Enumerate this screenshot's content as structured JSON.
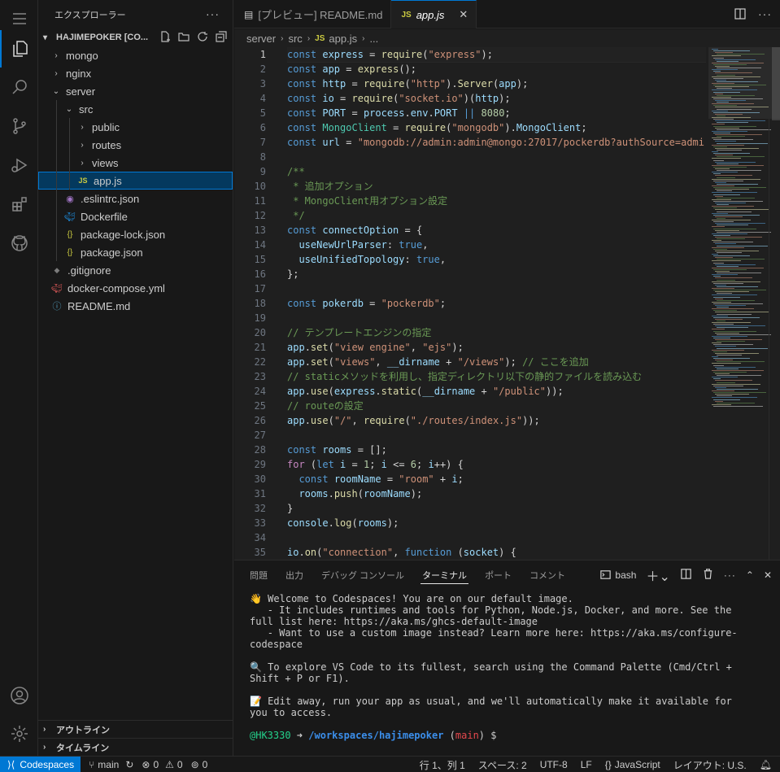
{
  "explorer": {
    "title": "エクスプローラー",
    "project": "HAJIMEPOKER [CO...",
    "tree": [
      {
        "label": "mongo",
        "depth": 0,
        "type": "folder",
        "open": false
      },
      {
        "label": "nginx",
        "depth": 0,
        "type": "folder",
        "open": false
      },
      {
        "label": "server",
        "depth": 0,
        "type": "folder",
        "open": true
      },
      {
        "label": "src",
        "depth": 1,
        "type": "folder",
        "open": true
      },
      {
        "label": "public",
        "depth": 2,
        "type": "folder",
        "open": false
      },
      {
        "label": "routes",
        "depth": 2,
        "type": "folder",
        "open": false
      },
      {
        "label": "views",
        "depth": 2,
        "type": "folder",
        "open": false
      },
      {
        "label": "app.js",
        "depth": 2,
        "type": "js",
        "selected": true
      },
      {
        "label": ".eslintrc.json",
        "depth": 1,
        "type": "eslint"
      },
      {
        "label": "Dockerfile",
        "depth": 1,
        "type": "docker"
      },
      {
        "label": "package-lock.json",
        "depth": 1,
        "type": "json"
      },
      {
        "label": "package.json",
        "depth": 1,
        "type": "json"
      },
      {
        "label": ".gitignore",
        "depth": 0,
        "type": "git"
      },
      {
        "label": "docker-compose.yml",
        "depth": 0,
        "type": "compose"
      },
      {
        "label": "README.md",
        "depth": 0,
        "type": "info"
      }
    ],
    "outline": "アウトライン",
    "timeline": "タイムライン"
  },
  "tabs": [
    {
      "label": "[プレビュー] README.md",
      "active": false,
      "icon": "preview-icon"
    },
    {
      "label": "app.js",
      "active": true,
      "icon": "js-icon"
    }
  ],
  "breadcrumb": {
    "items": [
      "server",
      "src",
      "app.js",
      "..."
    ]
  },
  "editor": {
    "current_line": 1,
    "lines": [
      [
        [
          "k",
          "const "
        ],
        [
          "v",
          "express"
        ],
        [
          "p",
          " = "
        ],
        [
          "f",
          "require"
        ],
        [
          "p",
          "("
        ],
        [
          "s",
          "\"express\""
        ],
        [
          "p",
          ");"
        ]
      ],
      [
        [
          "k",
          "const "
        ],
        [
          "v",
          "app"
        ],
        [
          "p",
          " = "
        ],
        [
          "f",
          "express"
        ],
        [
          "p",
          "();"
        ]
      ],
      [
        [
          "k",
          "const "
        ],
        [
          "v",
          "http"
        ],
        [
          "p",
          " = "
        ],
        [
          "f",
          "require"
        ],
        [
          "p",
          "("
        ],
        [
          "s",
          "\"http\""
        ],
        [
          "p",
          ")."
        ],
        [
          "f",
          "Server"
        ],
        [
          "p",
          "("
        ],
        [
          "v",
          "app"
        ],
        [
          "p",
          ");"
        ]
      ],
      [
        [
          "k",
          "const "
        ],
        [
          "v",
          "io"
        ],
        [
          "p",
          " = "
        ],
        [
          "f",
          "require"
        ],
        [
          "p",
          "("
        ],
        [
          "s",
          "\"socket.io\""
        ],
        [
          "p",
          ")("
        ],
        [
          "v",
          "http"
        ],
        [
          "p",
          ");"
        ]
      ],
      [
        [
          "k",
          "const "
        ],
        [
          "v",
          "PORT"
        ],
        [
          "p",
          " = "
        ],
        [
          "v",
          "process"
        ],
        [
          "p",
          "."
        ],
        [
          "v",
          "env"
        ],
        [
          "p",
          "."
        ],
        [
          "v",
          "PORT"
        ],
        [
          "p",
          " "
        ],
        [
          "k",
          "||"
        ],
        [
          "p",
          " "
        ],
        [
          "n",
          "8080"
        ],
        [
          "p",
          ";"
        ]
      ],
      [
        [
          "k",
          "const "
        ],
        [
          "cl",
          "MongoClient"
        ],
        [
          "p",
          " = "
        ],
        [
          "f",
          "require"
        ],
        [
          "p",
          "("
        ],
        [
          "s",
          "\"mongodb\""
        ],
        [
          "p",
          ")."
        ],
        [
          "v",
          "MongoClient"
        ],
        [
          "p",
          ";"
        ]
      ],
      [
        [
          "k",
          "const "
        ],
        [
          "v",
          "url"
        ],
        [
          "p",
          " = "
        ],
        [
          "s",
          "\"mongodb://admin:admin@mongo:27017/pockerdb?authSource=admi"
        ]
      ],
      [],
      [
        [
          "c",
          "/**"
        ]
      ],
      [
        [
          "c",
          " * 追加オプション"
        ]
      ],
      [
        [
          "c",
          " * MongoClient用オプション設定"
        ]
      ],
      [
        [
          "c",
          " */"
        ]
      ],
      [
        [
          "k",
          "const "
        ],
        [
          "v",
          "connectOption"
        ],
        [
          "p",
          " = {"
        ]
      ],
      [
        [
          "p",
          "  "
        ],
        [
          "v",
          "useNewUrlParser"
        ],
        [
          "p",
          ": "
        ],
        [
          "k",
          "true"
        ],
        [
          "p",
          ","
        ]
      ],
      [
        [
          "p",
          "  "
        ],
        [
          "v",
          "useUnifiedTopology"
        ],
        [
          "p",
          ": "
        ],
        [
          "k",
          "true"
        ],
        [
          "p",
          ","
        ]
      ],
      [
        [
          "p",
          "};"
        ]
      ],
      [],
      [
        [
          "k",
          "const "
        ],
        [
          "v",
          "pokerdb"
        ],
        [
          "p",
          " = "
        ],
        [
          "s",
          "\"pockerdb\""
        ],
        [
          "p",
          ";"
        ]
      ],
      [],
      [
        [
          "c",
          "// テンプレートエンジンの指定"
        ]
      ],
      [
        [
          "v",
          "app"
        ],
        [
          "p",
          "."
        ],
        [
          "f",
          "set"
        ],
        [
          "p",
          "("
        ],
        [
          "s",
          "\"view engine\""
        ],
        [
          "p",
          ", "
        ],
        [
          "s",
          "\"ejs\""
        ],
        [
          "p",
          ");"
        ]
      ],
      [
        [
          "v",
          "app"
        ],
        [
          "p",
          "."
        ],
        [
          "f",
          "set"
        ],
        [
          "p",
          "("
        ],
        [
          "s",
          "\"views\""
        ],
        [
          "p",
          ", "
        ],
        [
          "v",
          "__dirname"
        ],
        [
          "p",
          " + "
        ],
        [
          "s",
          "\"/views\""
        ],
        [
          "p",
          "); "
        ],
        [
          "c",
          "// ここを追加"
        ]
      ],
      [
        [
          "c",
          "// staticメソッドを利用し、指定ディレクトリ以下の静的ファイルを読み込む"
        ]
      ],
      [
        [
          "v",
          "app"
        ],
        [
          "p",
          "."
        ],
        [
          "f",
          "use"
        ],
        [
          "p",
          "("
        ],
        [
          "v",
          "express"
        ],
        [
          "p",
          "."
        ],
        [
          "f",
          "static"
        ],
        [
          "p",
          "("
        ],
        [
          "v",
          "__dirname"
        ],
        [
          "p",
          " + "
        ],
        [
          "s",
          "\"/public\""
        ],
        [
          "p",
          "));"
        ]
      ],
      [
        [
          "c",
          "// routeの設定"
        ]
      ],
      [
        [
          "v",
          "app"
        ],
        [
          "p",
          "."
        ],
        [
          "f",
          "use"
        ],
        [
          "p",
          "("
        ],
        [
          "s",
          "\"/\""
        ],
        [
          "p",
          ", "
        ],
        [
          "f",
          "require"
        ],
        [
          "p",
          "("
        ],
        [
          "s",
          "\"./routes/index.js\""
        ],
        [
          "p",
          "));"
        ]
      ],
      [],
      [
        [
          "k",
          "const "
        ],
        [
          "v",
          "rooms"
        ],
        [
          "p",
          " = [];"
        ]
      ],
      [
        [
          "kc",
          "for"
        ],
        [
          "p",
          " ("
        ],
        [
          "k",
          "let "
        ],
        [
          "v",
          "i"
        ],
        [
          "p",
          " = "
        ],
        [
          "n",
          "1"
        ],
        [
          "p",
          "; "
        ],
        [
          "v",
          "i"
        ],
        [
          "p",
          " <= "
        ],
        [
          "n",
          "6"
        ],
        [
          "p",
          "; "
        ],
        [
          "v",
          "i"
        ],
        [
          "p",
          "++) {"
        ]
      ],
      [
        [
          "p",
          "  "
        ],
        [
          "k",
          "const "
        ],
        [
          "v",
          "roomName"
        ],
        [
          "p",
          " = "
        ],
        [
          "s",
          "\"room\""
        ],
        [
          "p",
          " + "
        ],
        [
          "v",
          "i"
        ],
        [
          "p",
          ";"
        ]
      ],
      [
        [
          "p",
          "  "
        ],
        [
          "v",
          "rooms"
        ],
        [
          "p",
          "."
        ],
        [
          "f",
          "push"
        ],
        [
          "p",
          "("
        ],
        [
          "v",
          "roomName"
        ],
        [
          "p",
          ");"
        ]
      ],
      [
        [
          "p",
          "}"
        ]
      ],
      [
        [
          "v",
          "console"
        ],
        [
          "p",
          "."
        ],
        [
          "f",
          "log"
        ],
        [
          "p",
          "("
        ],
        [
          "v",
          "rooms"
        ],
        [
          "p",
          ");"
        ]
      ],
      [],
      [
        [
          "v",
          "io"
        ],
        [
          "p",
          "."
        ],
        [
          "f",
          "on"
        ],
        [
          "p",
          "("
        ],
        [
          "s",
          "\"connection\""
        ],
        [
          "p",
          ", "
        ],
        [
          "k",
          "function "
        ],
        [
          "p",
          "("
        ],
        [
          "v",
          "socket"
        ],
        [
          "p",
          ") {"
        ]
      ]
    ]
  },
  "panel": {
    "tabs": [
      {
        "label": "問題",
        "active": false
      },
      {
        "label": "出力",
        "active": false
      },
      {
        "label": "デバッグ コンソール",
        "active": false
      },
      {
        "label": "ターミナル",
        "active": true
      },
      {
        "label": "ポート",
        "active": false
      },
      {
        "label": "コメント",
        "active": false
      }
    ],
    "shell": "bash",
    "terminal_lines": [
      "👋 Welcome to Codespaces! You are on our default image.",
      "   - It includes runtimes and tools for Python, Node.js, Docker, and more. See the full list here: https://aka.ms/ghcs-default-image",
      "   - Want to use a custom image instead? Learn more here: https://aka.ms/configure-codespace",
      "",
      "🔍 To explore VS Code to its fullest, search using the Command Palette (Cmd/Ctrl + Shift + P or F1).",
      "",
      "📝 Edit away, run your app as usual, and we'll automatically make it available for you to access.",
      ""
    ],
    "prompt": {
      "user": "@HK3330",
      "arrow": " ➜ ",
      "path": "/workspaces/hajimepoker",
      "branch_open": " (",
      "branch": "main",
      "branch_close": ")",
      "dollar": " $ "
    }
  },
  "status": {
    "remote": "Codespaces",
    "branch": "main",
    "errors": "0",
    "warnings": "0",
    "ports": "0",
    "position": "行 1、列 1",
    "spaces": "スペース: 2",
    "encoding": "UTF-8",
    "eol": "LF",
    "language": "JavaScript",
    "layout": "レイアウト: U.S."
  }
}
